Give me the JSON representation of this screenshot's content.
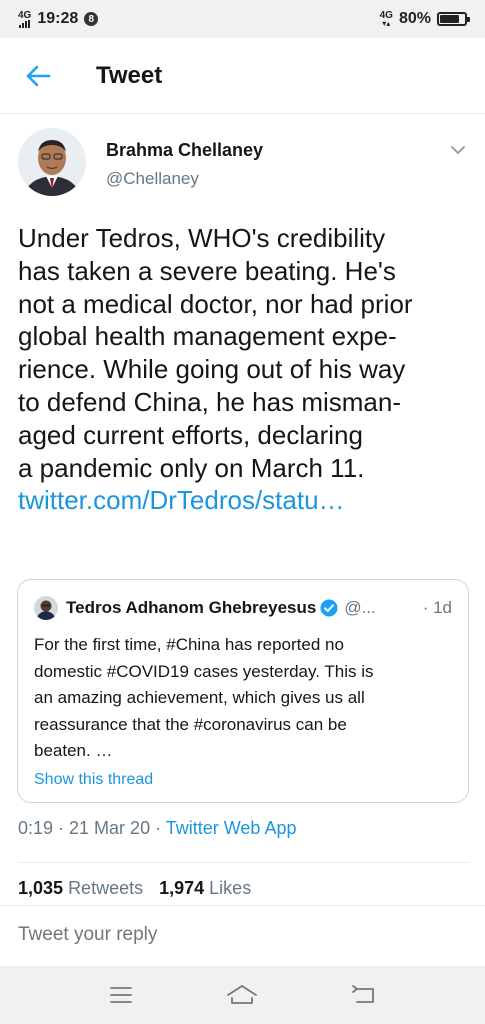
{
  "status_bar": {
    "network": "4G",
    "time": "19:28",
    "notification_badge": "8",
    "right_network": "4G",
    "battery_percent": "80%",
    "battery_level": 0.8
  },
  "header": {
    "title": "Tweet"
  },
  "tweet": {
    "author_name": "Brahma Chellaney",
    "author_handle": "@Chellaney",
    "text_lines": [
      "Under Tedros, WHO's credibility",
      "has taken a severe beating. He's",
      "not a medical doctor, nor had prior",
      "global health management expe-",
      "rience. While going out of his way",
      "to defend China, he has misman-",
      "aged current efforts, declaring",
      "a pandemic only on March 11."
    ],
    "link_text": "twitter.com/DrTedros/statu…",
    "quoted": {
      "name": "Tedros Adhanom Ghebreyesus",
      "handle": "@...",
      "time": "· 1d",
      "text_lines": [
        "For the first time, #China has reported no",
        "domestic #COVID19 cases yesterday. This is",
        "an amazing achievement, which gives us all",
        "reassurance that the #coronavirus can be",
        "beaten. …"
      ],
      "show_thread": "Show this thread"
    },
    "timestamp": "0:19 · 21 Mar 20 · ",
    "source_app": "Twitter Web App",
    "retweet_count": "1,035",
    "retweet_label": "Retweets",
    "like_count": "1,974",
    "like_label": "Likes"
  },
  "reply": {
    "placeholder": "Tweet your reply"
  },
  "colors": {
    "accent": "#1b95e0",
    "secondary_text": "#657786",
    "primary_text": "#14171a",
    "verified": "#1da1f2"
  },
  "icons": [
    "back-arrow-icon",
    "chevron-down-icon",
    "verified-icon",
    "menu-icon",
    "home-icon",
    "back-nav-icon"
  ]
}
